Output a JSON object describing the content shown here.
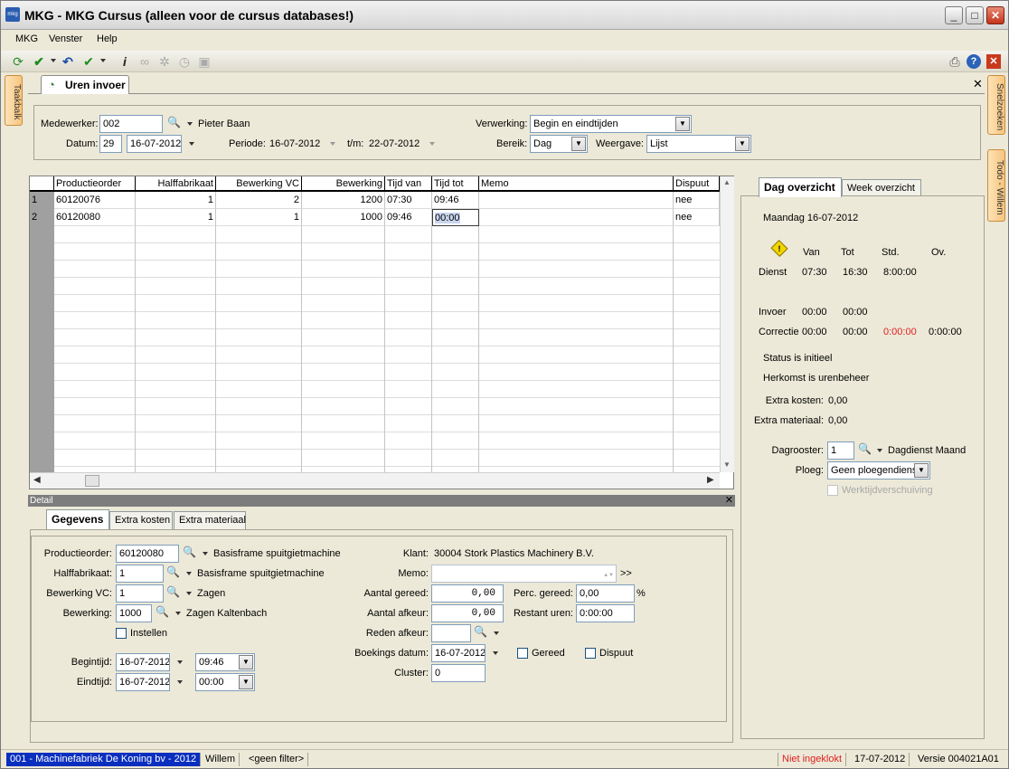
{
  "window": {
    "title": "MKG - MKG Cursus (alleen voor de cursus databases!)",
    "icon": "mkg",
    "btn_min": "_",
    "btn_max": "□",
    "btn_close": "✕"
  },
  "menu": [
    "MKG",
    "Venster",
    "Help"
  ],
  "side": {
    "left_tab": "Taakbalk",
    "right_tab1": "Snelzoeken",
    "right_tab2": "Todo - Willem"
  },
  "doc": {
    "tab_label": "Uren invoer",
    "close": "✕"
  },
  "header": {
    "medewerker_label": "Medewerker:",
    "medewerker_value": "002",
    "medewerker_name": "Pieter Baan",
    "datum_label": "Datum:",
    "datum_day": "29",
    "datum_value": "16-07-2012",
    "periode_label": "Periode:",
    "periode_from": "16-07-2012",
    "tm_label": "t/m:",
    "periode_to": "22-07-2012",
    "verwerking_label": "Verwerking:",
    "verwerking_value": "Begin en eindtijden",
    "bereik_label": "Bereik:",
    "bereik_value": "Dag",
    "weergave_label": "Weergave:",
    "weergave_value": "Lijst"
  },
  "grid": {
    "columns": [
      "Productieorder",
      "Halffabrikaat",
      "Bewerking VC",
      "Bewerking",
      "Tijd van",
      "Tijd tot",
      "Memo",
      "Dispuut"
    ],
    "rows": [
      {
        "num": "1",
        "order": "60120076",
        "half": "1",
        "bvc": "2",
        "bew": "1200",
        "van": "07:30",
        "tot": "09:46",
        "memo": "",
        "disp": "nee"
      },
      {
        "num": "2",
        "order": "60120080",
        "half": "1",
        "bvc": "1",
        "bew": "1000",
        "van": "09:46",
        "tot": "00:00",
        "memo": "",
        "disp": "nee"
      }
    ]
  },
  "detail": {
    "bar_title": "Detail",
    "close": "✕",
    "tabs": [
      "Gegevens",
      "Extra kosten",
      "Extra materiaal"
    ],
    "productieorder_label": "Productieorder:",
    "productieorder_value": "60120080",
    "productieorder_desc": "Basisframe spuitgietmachine",
    "halffabrikaat_label": "Halffabrikaat:",
    "halffabrikaat_value": "1",
    "halffabrikaat_desc": "Basisframe spuitgietmachine",
    "bewerkingvc_label": "Bewerking VC:",
    "bewerkingvc_value": "1",
    "bewerkingvc_desc": "Zagen",
    "bewerking_label": "Bewerking:",
    "bewerking_value": "1000",
    "bewerking_desc": "Zagen Kaltenbach",
    "instellen_label": "Instellen",
    "begintijd_label": "Begintijd:",
    "begintijd_date": "16-07-2012",
    "begintijd_time": "09:46",
    "eindtijd_label": "Eindtijd:",
    "eindtijd_date": "16-07-2012",
    "eindtijd_time": "00:00",
    "klant_label": "Klant:",
    "klant_value": "30004 Stork Plastics Machinery B.V.",
    "memo_label": "Memo:",
    "memo_more": ">>",
    "aantal_gereed_label": "Aantal gereed:",
    "aantal_gereed_value": "0,00",
    "aantal_afkeur_label": "Aantal afkeur:",
    "aantal_afkeur_value": "0,00",
    "reden_afkeur_label": "Reden afkeur:",
    "boekings_label": "Boekings datum:",
    "boekings_value": "16-07-2012",
    "cluster_label": "Cluster:",
    "cluster_value": "0",
    "perc_label": "Perc. gereed:",
    "perc_value": "0,00",
    "perc_unit": "%",
    "restant_label": "Restant uren:",
    "restant_value": "0:00:00",
    "gereed_label": "Gereed",
    "dispuut_label": "Dispuut"
  },
  "overview": {
    "tabs": [
      "Dag overzicht",
      "Week overzicht"
    ],
    "date_line": "Maandag 16-07-2012",
    "col_van": "Van",
    "col_tot": "Tot",
    "col_std": "Std.",
    "col_ov": "Ov.",
    "dienst_label": "Dienst",
    "dienst_van": "07:30",
    "dienst_tot": "16:30",
    "dienst_std": "8:00:00",
    "invoer_label": "Invoer",
    "invoer_van": "00:00",
    "invoer_tot": "00:00",
    "correctie_label": "Correctie",
    "correctie_van": "00:00",
    "correctie_tot": "00:00",
    "correctie_std": "0:00:00",
    "correctie_ov": "0:00:00",
    "status": "Status is initieel",
    "herkomst": "Herkomst is urenbeheer",
    "extra_kosten_label": "Extra kosten:",
    "extra_kosten_value": "0,00",
    "extra_materiaal_label": "Extra materiaal:",
    "extra_materiaal_value": "0,00",
    "dagrooster_label": "Dagrooster:",
    "dagrooster_value": "1",
    "dagrooster_desc": "Dagdienst Maand",
    "ploeg_label": "Ploeg:",
    "ploeg_value": "Geen ploegendienst",
    "werktijd_label": "Werktijdverschuiving",
    "warning_color": "#f2d600",
    "red_color": "#e02020"
  },
  "statusbar": {
    "company": "001 - Machinefabriek De Koning bv - 2012",
    "user": "Willem",
    "filter": "<geen filter>",
    "clock": "Niet ingeklokt",
    "date": "17-07-2012",
    "version": "Versie 004021A01"
  }
}
